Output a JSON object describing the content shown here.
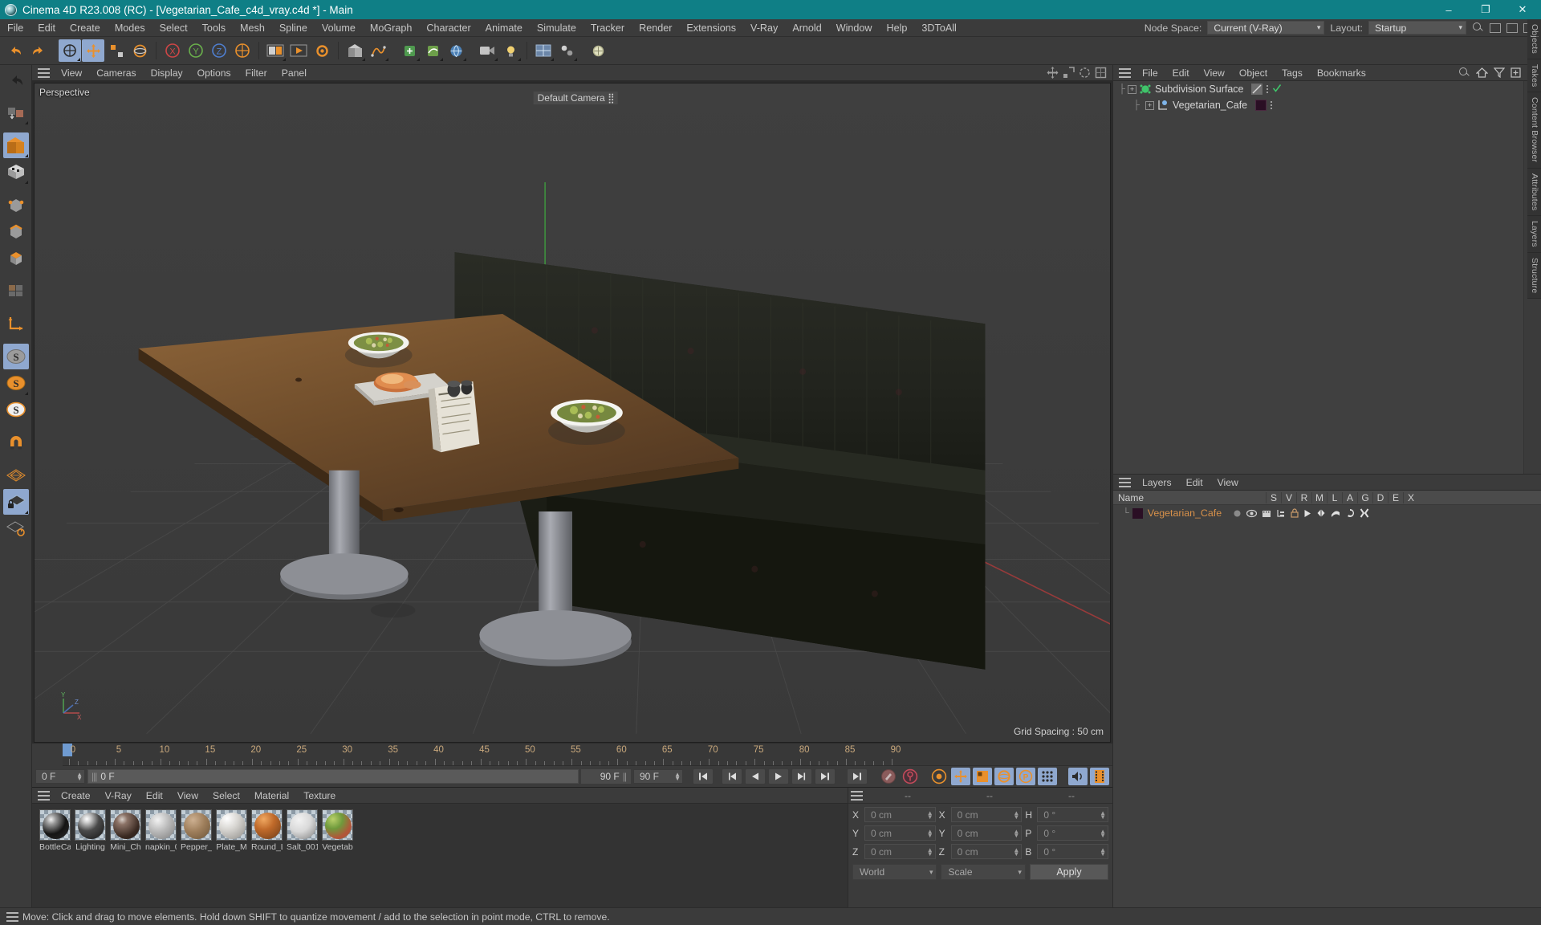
{
  "window": {
    "title": "Cinema 4D R23.008 (RC) - [Vegetarian_Cafe_c4d_vray.c4d *] - Main",
    "minimize": "–",
    "maximize": "❐",
    "close": "✕"
  },
  "menubar": {
    "items": [
      "File",
      "Edit",
      "Create",
      "Modes",
      "Select",
      "Tools",
      "Mesh",
      "Spline",
      "Volume",
      "MoGraph",
      "Character",
      "Animate",
      "Simulate",
      "Tracker",
      "Render",
      "Extensions",
      "V-Ray",
      "Arnold",
      "Window",
      "Help",
      "3DToAll"
    ],
    "node_space_label": "Node Space:",
    "node_space_value": "Current (V-Ray)",
    "layout_label": "Layout:",
    "layout_value": "Startup"
  },
  "viewport": {
    "menu": [
      "View",
      "Cameras",
      "Display",
      "Options",
      "Filter",
      "Panel"
    ],
    "projection_label": "Perspective",
    "camera_label": "Default Camera",
    "grid_spacing": "Grid Spacing : 50 cm",
    "axis": {
      "x": "X",
      "y": "Y",
      "z": "Z"
    }
  },
  "timeline": {
    "ruler_labels": [
      "0",
      "5",
      "10",
      "15",
      "20",
      "25",
      "30",
      "35",
      "40",
      "45",
      "50",
      "55",
      "60",
      "65",
      "70",
      "75",
      "80",
      "85",
      "90"
    ],
    "current_frame": "0 F",
    "current_frame_preview": "0 F",
    "end_frame_locked": "90 F",
    "end_frame": "90 F",
    "playhead_frame": "0 F",
    "right_frame_field": "0 F"
  },
  "material_manager": {
    "menu": [
      "Create",
      "V-Ray",
      "Edit",
      "View",
      "Select",
      "Material",
      "Texture"
    ],
    "materials": [
      {
        "name": "BottleCa",
        "color": "#1c1c1c",
        "type": "glass"
      },
      {
        "name": "Lighting",
        "color": "#3a3a3a",
        "type": "mixed"
      },
      {
        "name": "Mini_Ch",
        "color": "#4b3a33",
        "type": "dark"
      },
      {
        "name": "napkin_0",
        "color": "#b9b9b9",
        "type": "matte"
      },
      {
        "name": "Pepper_",
        "color": "#9f7f5c",
        "type": "noise"
      },
      {
        "name": "Plate_M",
        "color": "#d8d6d2",
        "type": "gloss"
      },
      {
        "name": "Round_L",
        "color": "#c06a2a",
        "type": "rust"
      },
      {
        "name": "Salt_001",
        "color": "#d9d9d9",
        "type": "matte"
      },
      {
        "name": "Vegetab",
        "color": "#7c9a4a",
        "type": "veg"
      }
    ]
  },
  "coordinates": {
    "header_dashes": [
      "--",
      "--",
      "--"
    ],
    "rows": [
      {
        "pos_label": "X",
        "pos_value": "0 cm",
        "size_label": "X",
        "size_value": "0 cm",
        "rot_label": "H",
        "rot_value": "0 °"
      },
      {
        "pos_label": "Y",
        "pos_value": "0 cm",
        "size_label": "Y",
        "size_value": "0 cm",
        "rot_label": "P",
        "rot_value": "0 °"
      },
      {
        "pos_label": "Z",
        "pos_value": "0 cm",
        "size_label": "Z",
        "size_value": "0 cm",
        "rot_label": "B",
        "rot_value": "0 °"
      }
    ],
    "space_value": "World",
    "mode_value": "Scale",
    "apply_label": "Apply"
  },
  "object_manager": {
    "menu": [
      "File",
      "Edit",
      "View",
      "Object",
      "Tags",
      "Bookmarks"
    ],
    "items": [
      {
        "name": "Subdivision Surface",
        "indent": 0
      },
      {
        "name": "Vegetarian_Cafe",
        "indent": 1
      }
    ]
  },
  "layer_manager": {
    "menu": [
      "Layers",
      "Edit",
      "View"
    ],
    "columns": [
      "Name",
      "S",
      "V",
      "R",
      "M",
      "L",
      "A",
      "G",
      "D",
      "E",
      "X"
    ],
    "rows": [
      {
        "name": "Vegetarian_Cafe"
      }
    ]
  },
  "side_tabs": [
    "Objects",
    "Takes",
    "Content Browser",
    "Attributes",
    "Layers",
    "Structure"
  ],
  "statusbar": {
    "message": "Move: Click and drag to move elements. Hold down SHIFT to quantize movement / add to the selection in point mode, CTRL to remove."
  },
  "colors": {
    "title_bar": "#0f7f86",
    "accent_orange": "#e9902c",
    "highlight_blue": "#8fa8cf",
    "layer_text": "#d8914a"
  }
}
